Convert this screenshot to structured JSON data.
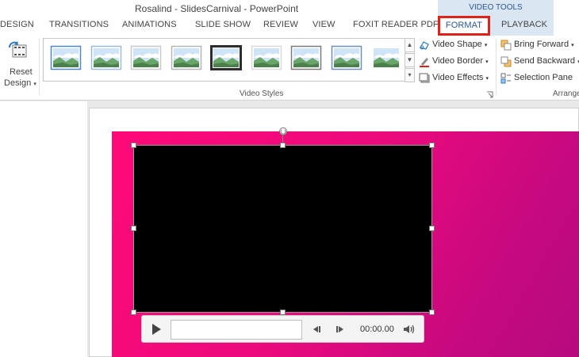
{
  "window": {
    "title": "Rosalind - SlidesCarnival - PowerPoint",
    "contextual_group": "VIDEO TOOLS"
  },
  "tabs": [
    {
      "id": "design",
      "label": "DESIGN"
    },
    {
      "id": "transitions",
      "label": "TRANSITIONS"
    },
    {
      "id": "animations",
      "label": "ANIMATIONS"
    },
    {
      "id": "slideshow",
      "label": "SLIDE SHOW"
    },
    {
      "id": "review",
      "label": "REVIEW"
    },
    {
      "id": "view",
      "label": "VIEW"
    },
    {
      "id": "foxit",
      "label": "FOXIT READER PDF"
    },
    {
      "id": "format",
      "label": "FORMAT",
      "selected": true,
      "highlight": "#e0201b"
    },
    {
      "id": "playback",
      "label": "PLAYBACK"
    }
  ],
  "ribbon": {
    "adjust": {
      "reset_line1": "Reset",
      "reset_line2": "Design",
      "reset_icon": "reset-design-icon"
    },
    "video_styles": {
      "group_label": "Video Styles",
      "thumbnail_count": 9,
      "thumbnail_icon": "landscape-picture-icon",
      "scroll_up": "▲",
      "scroll_down": "▼",
      "more": "▾"
    },
    "style_commands": {
      "video_shape": "Video Shape",
      "video_border": "Video Border",
      "video_effects": "Video Effects"
    },
    "arrange": {
      "group_label": "Arrange",
      "bring_forward": "Bring Forward",
      "send_backward": "Send Backward",
      "selection_pane": "Selection Pane"
    }
  },
  "slide": {
    "gradient_start": "#ff0a78",
    "gradient_end": "#b70a7f",
    "video_fill": "#000000"
  },
  "player": {
    "time": "00:00.00",
    "progress_fraction": 0,
    "play_icon": "play-icon",
    "back_icon": "skip-back-icon",
    "forward_icon": "skip-forward-icon",
    "volume_icon": "volume-icon"
  },
  "colors": {
    "accent": "#2b579a",
    "contextual_tab_bg": "#dbe6f3",
    "format_highlight": "#e0201b"
  }
}
